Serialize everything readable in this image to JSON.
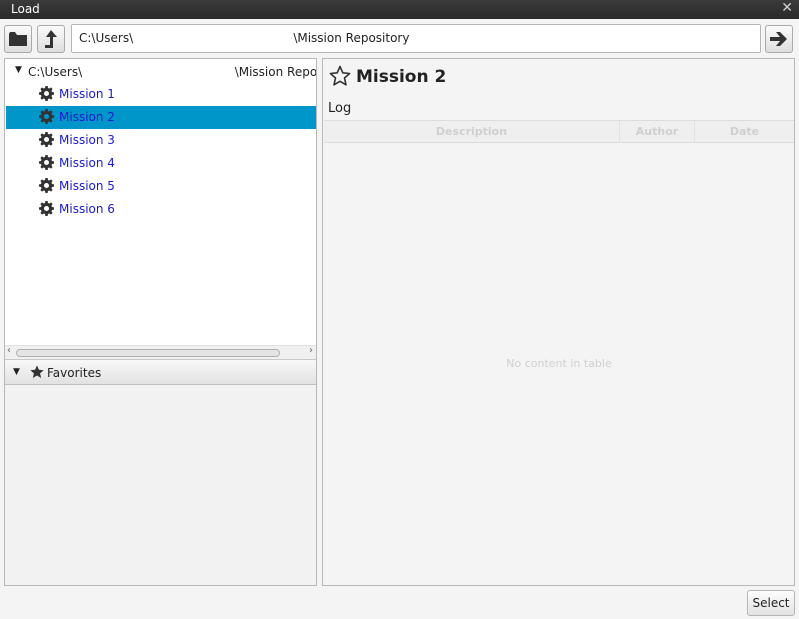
{
  "window": {
    "title": "Load",
    "close_glyph": "✕"
  },
  "toolbar": {
    "open_folder_icon": "folder-icon",
    "up_icon": "up-arrow-icon",
    "go_icon": "right-arrow-icon",
    "path_value": "C:\\Users\\                                          \\Mission Repository"
  },
  "tree": {
    "root": {
      "expand_glyph": "▼",
      "label": "C:\\Users\\                                        \\Mission Repos"
    },
    "items": [
      {
        "label": "Mission 1",
        "icon": "gear-icon",
        "selected": false
      },
      {
        "label": "Mission 2",
        "icon": "gear-icon",
        "selected": true
      },
      {
        "label": "Mission 3",
        "icon": "gear-icon",
        "selected": false
      },
      {
        "label": "Mission 4",
        "icon": "gear-icon",
        "selected": false
      },
      {
        "label": "Mission 5",
        "icon": "gear-icon",
        "selected": false
      },
      {
        "label": "Mission 6",
        "icon": "gear-icon",
        "selected": false
      }
    ]
  },
  "favorites": {
    "expand_glyph": "▼",
    "label": "Favorites",
    "icon": "star-icon"
  },
  "details": {
    "title": "Mission 2",
    "title_icon": "star-outline-icon",
    "log_label": "Log",
    "columns": [
      "Description",
      "Author",
      "Date"
    ],
    "empty_text": "No content in table"
  },
  "footer": {
    "select_label": "Select"
  },
  "colors": {
    "selection": "#0096c9",
    "link_text": "#1a1ad0",
    "titlebar": "#2f2f2f"
  }
}
